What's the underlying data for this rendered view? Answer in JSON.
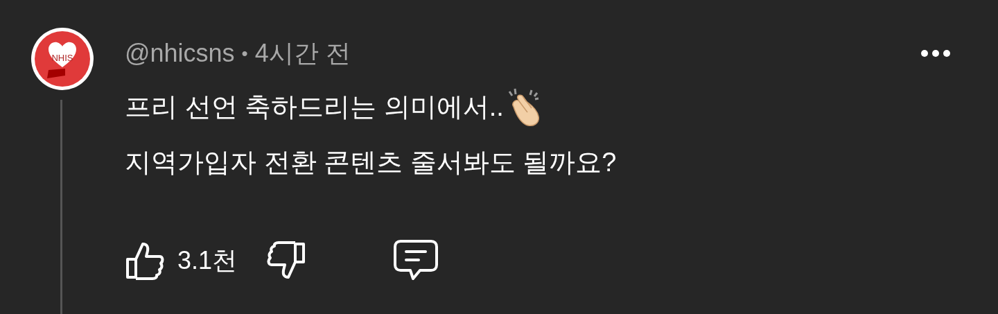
{
  "comment": {
    "avatar_label": "NHIS",
    "author": "@nhicsns",
    "separator": "•",
    "time": "4시간 전",
    "lines": [
      "프리 선언 축하드리는 의미에서..",
      "지역가입자 전환 콘텐츠 줄서봐도 될까요?"
    ],
    "likes": "3.1천"
  }
}
